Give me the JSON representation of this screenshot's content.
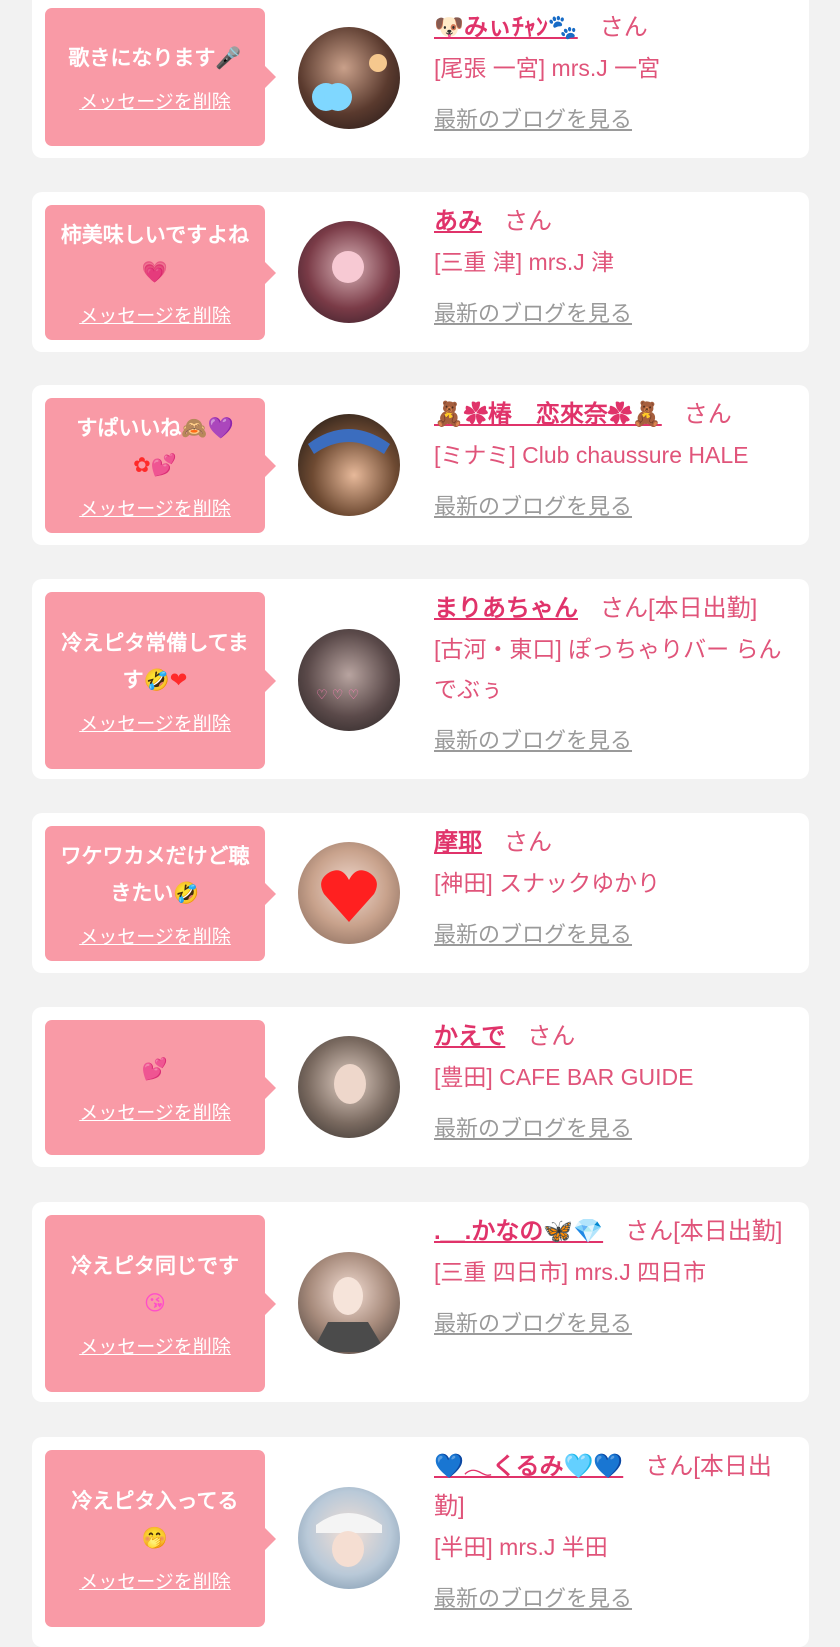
{
  "common": {
    "delete_label": "メッセージを削除",
    "blog_label": "最新のブログを見る",
    "san": "さん"
  },
  "items": [
    {
      "message": "歌きになります",
      "message_emoji": "🎤",
      "name": "🐶みぃﾁｬﾝ🐾",
      "suffix": "さん",
      "shop": "[尾張 一宮] mrs.J 一宮"
    },
    {
      "message": "柿美味しいですよね",
      "message_emoji": "💗",
      "name": "あみ",
      "suffix": "さん",
      "shop": "[三重 津] mrs.J 津"
    },
    {
      "message": "すぱいいね🙈💜",
      "message_emoji": "✿💕",
      "name": "🧸✿椿　恋來奈✿🧸",
      "suffix": "さん",
      "shop": "[ミナミ] Club chaussure HALE"
    },
    {
      "message": "冷えピタ常備してます",
      "message_emoji": "🤣❤",
      "name": "まりあちゃん",
      "suffix": "さん[本日出勤]",
      "shop": "[古河・東口] ぽっちゃりバー らんでぶぅ"
    },
    {
      "message": "ワケワカメだけど聴きたい",
      "message_emoji": "🤣",
      "name": "摩耶",
      "suffix": "さん",
      "shop": "[神田] スナックゆかり"
    },
    {
      "message": "",
      "message_emoji": "💕",
      "name": "かえで",
      "suffix": "さん",
      "shop": "[豊田] CAFE BAR GUIDE"
    },
    {
      "message": "冷えピタ同じです",
      "message_emoji": "😘",
      "name": ".＿.かなの🦋💎",
      "suffix": "さん[本日出勤]",
      "shop": "[三重 四日市] mrs.J 四日市"
    },
    {
      "message": "冷えピタ入ってる",
      "message_emoji": "🤭",
      "name": "💙𓂃くるみ🩵💙",
      "suffix": "さん[本日出勤]",
      "shop": "[半田] mrs.J 半田"
    }
  ]
}
